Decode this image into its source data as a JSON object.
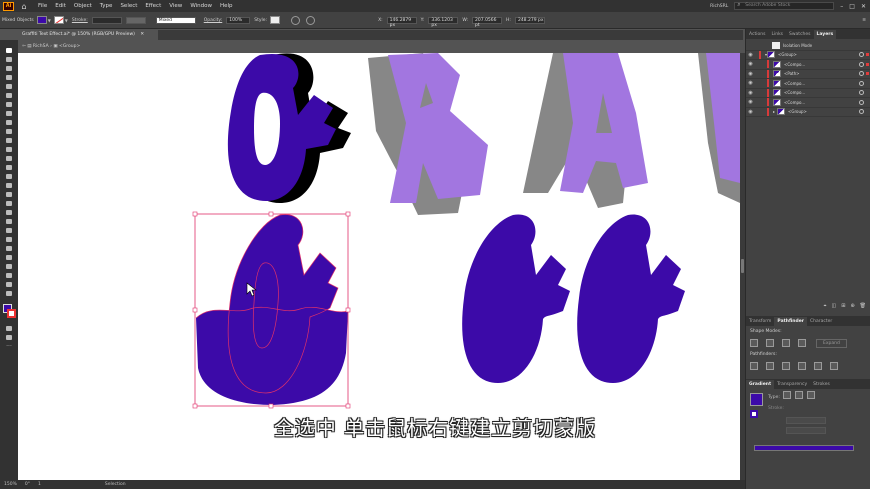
{
  "app": {
    "logo": "Ai",
    "search_placeholder": "Search Adobe Stock",
    "user": "RichSRL"
  },
  "menu": [
    "File",
    "Edit",
    "Object",
    "Type",
    "Select",
    "Effect",
    "View",
    "Window",
    "Help"
  ],
  "control": {
    "selection_label": "Mixed Objects",
    "stroke_label": "Stroke:",
    "profile_value": "Mixed",
    "opacity_label": "Opacity:",
    "opacity_value": "100%",
    "style_label": "Style:",
    "x_label": "X:",
    "x_value": "146.2879 px",
    "y_label": "Y:",
    "y_value": "336.1203 px",
    "w_label": "W:",
    "w_value": "207.0566 pt",
    "h_label": "H:",
    "h_value": "248.279 px",
    "fill_color": "#3c0aa8"
  },
  "document": {
    "tab_title": "Graffiti Text Effect.ai* @ 150% (RGB/GPU Preview)",
    "breadcrumb_layer": "RichSA",
    "breadcrumb_group": "<Group>"
  },
  "colors": {
    "purple": "#3c0aa8",
    "light_purple": "#a276e0",
    "gray_shadow": "#878787",
    "black": "#000000",
    "selection": "#e0306a"
  },
  "subtitle": "全选中 单击鼠标右键建立剪切蒙版",
  "status": {
    "zoom": "150%",
    "angle": "0°",
    "artboard": "1",
    "tool": "Selection"
  },
  "panels": {
    "top_tabs": [
      "Actions",
      "Links",
      "Swatches",
      "Layers"
    ],
    "isolation_label": "Isolation Mode",
    "layers": [
      "<Group>",
      "<Compo...",
      "<Path>",
      "<Compo...",
      "<Compo...",
      "<Compo...",
      "<Group>"
    ],
    "mid_tabs": [
      "Transform",
      "Pathfinder",
      "Character"
    ],
    "shape_modes_label": "Shape Modes:",
    "expand_label": "Expand",
    "pathfinders_label": "Pathfinders:",
    "bottom_tabs": [
      "Gradient",
      "Transparency",
      "Strokes"
    ],
    "type_label": "Type:",
    "stroke_label": "Stroke:"
  }
}
